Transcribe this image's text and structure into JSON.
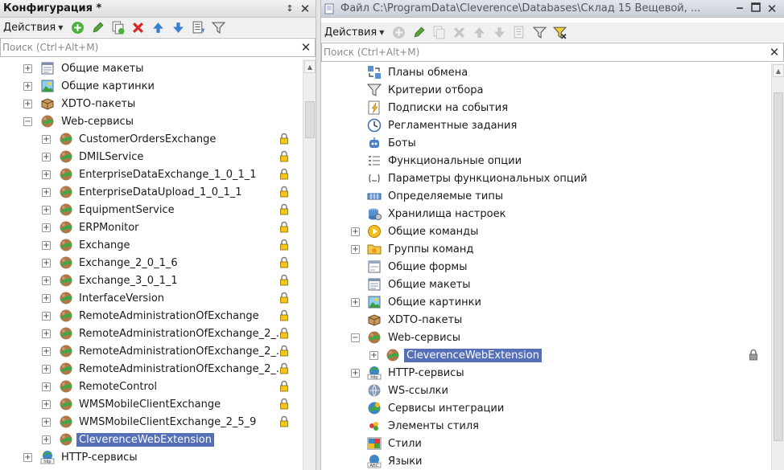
{
  "left_panel": {
    "title": "Конфигурация *",
    "actions_label": "Действия",
    "search_placeholder": "Поиск (Ctrl+Alt+M)",
    "tree": [
      {
        "label": "Общие макеты",
        "icon": "layout-icon",
        "expander": "+",
        "level": 0
      },
      {
        "label": "Общие картинки",
        "icon": "picture-icon",
        "expander": "+",
        "level": 0
      },
      {
        "label": "XDTO-пакеты",
        "icon": "xdto-package-icon",
        "expander": "+",
        "level": 0
      },
      {
        "label": "Web-сервисы",
        "icon": "web-service-icon",
        "expander": "−",
        "level": 0
      },
      {
        "label": "CustomerOrdersExchange",
        "icon": "web-service-icon",
        "expander": "+",
        "level": 1,
        "locked": true
      },
      {
        "label": "DMILService",
        "icon": "web-service-icon",
        "expander": "+",
        "level": 1,
        "locked": true
      },
      {
        "label": "EnterpriseDataExchange_1_0_1_1",
        "icon": "web-service-icon",
        "expander": "+",
        "level": 1,
        "locked": true
      },
      {
        "label": "EnterpriseDataUpload_1_0_1_1",
        "icon": "web-service-icon",
        "expander": "+",
        "level": 1,
        "locked": true
      },
      {
        "label": "EquipmentService",
        "icon": "web-service-icon",
        "expander": "+",
        "level": 1,
        "locked": true
      },
      {
        "label": "ERPMonitor",
        "icon": "web-service-icon",
        "expander": "+",
        "level": 1,
        "locked": true
      },
      {
        "label": "Exchange",
        "icon": "web-service-icon",
        "expander": "+",
        "level": 1,
        "locked": true
      },
      {
        "label": "Exchange_2_0_1_6",
        "icon": "web-service-icon",
        "expander": "+",
        "level": 1,
        "locked": true
      },
      {
        "label": "Exchange_3_0_1_1",
        "icon": "web-service-icon",
        "expander": "+",
        "level": 1,
        "locked": true
      },
      {
        "label": "InterfaceVersion",
        "icon": "web-service-icon",
        "expander": "+",
        "level": 1,
        "locked": true
      },
      {
        "label": "RemoteAdministrationOfExchange",
        "icon": "web-service-icon",
        "expander": "+",
        "level": 1,
        "locked": true
      },
      {
        "label": "RemoteAdministrationOfExchange_2_...",
        "icon": "web-service-icon",
        "expander": "+",
        "level": 1,
        "locked": true
      },
      {
        "label": "RemoteAdministrationOfExchange_2_...",
        "icon": "web-service-icon",
        "expander": "+",
        "level": 1,
        "locked": true
      },
      {
        "label": "RemoteAdministrationOfExchange_2_...",
        "icon": "web-service-icon",
        "expander": "+",
        "level": 1,
        "locked": true
      },
      {
        "label": "RemoteControl",
        "icon": "web-service-icon",
        "expander": "+",
        "level": 1,
        "locked": true
      },
      {
        "label": "WMSMobileClientExchange",
        "icon": "web-service-icon",
        "expander": "+",
        "level": 1,
        "locked": true
      },
      {
        "label": "WMSMobileClientExchange_2_5_9",
        "icon": "web-service-icon",
        "expander": "+",
        "level": 1,
        "locked": true
      },
      {
        "label": "CleverenceWebExtension",
        "icon": "web-service-icon",
        "expander": "+",
        "level": 1,
        "selected": true
      },
      {
        "label": "HTTP-сервисы",
        "icon": "http-service-icon",
        "expander": "+",
        "level": 0
      }
    ]
  },
  "right_panel": {
    "title": "Файл C:\\ProgramData\\Cleverence\\Databases\\Склад 15 Вещевой, ...",
    "actions_label": "Действия",
    "search_placeholder": "Поиск (Ctrl+Alt+M)",
    "tree": [
      {
        "label": "Планы обмена",
        "icon": "exchange-plan-icon",
        "level": 0
      },
      {
        "label": "Критерии отбора",
        "icon": "filter-criteria-icon",
        "level": 0
      },
      {
        "label": "Подписки на события",
        "icon": "event-subscription-icon",
        "level": 0
      },
      {
        "label": "Регламентные задания",
        "icon": "scheduled-job-icon",
        "level": 0
      },
      {
        "label": "Боты",
        "icon": "bot-icon",
        "level": 0
      },
      {
        "label": "Функциональные опции",
        "icon": "functional-option-icon",
        "level": 0
      },
      {
        "label": "Параметры функциональных опций",
        "icon": "functional-option-param-icon",
        "level": 0
      },
      {
        "label": "Определяемые типы",
        "icon": "defined-type-icon",
        "level": 0
      },
      {
        "label": "Хранилища настроек",
        "icon": "settings-storage-icon",
        "level": 0
      },
      {
        "label": "Общие команды",
        "icon": "common-command-icon",
        "expander": "+",
        "level": 0
      },
      {
        "label": "Группы команд",
        "icon": "command-group-icon",
        "expander": "+",
        "level": 0
      },
      {
        "label": "Общие формы",
        "icon": "common-form-icon",
        "level": 0
      },
      {
        "label": "Общие макеты",
        "icon": "layout-icon",
        "level": 0
      },
      {
        "label": "Общие картинки",
        "icon": "picture-icon",
        "expander": "+",
        "level": 0
      },
      {
        "label": "XDTO-пакеты",
        "icon": "xdto-package-icon",
        "level": 0
      },
      {
        "label": "Web-сервисы",
        "icon": "web-service-icon",
        "expander": "−",
        "level": 0
      },
      {
        "label": "CleverenceWebExtension",
        "icon": "web-service-icon",
        "expander": "+",
        "level": 1,
        "selected": true,
        "locked": true
      },
      {
        "label": "HTTP-сервисы",
        "icon": "http-service-icon",
        "expander": "+",
        "level": 0
      },
      {
        "label": "WS-ссылки",
        "icon": "ws-reference-icon",
        "level": 0
      },
      {
        "label": "Сервисы интеграции",
        "icon": "integration-service-icon",
        "level": 0
      },
      {
        "label": "Элементы стиля",
        "icon": "style-item-icon",
        "level": 0
      },
      {
        "label": "Стили",
        "icon": "style-icon",
        "level": 0
      },
      {
        "label": "Языки",
        "icon": "language-icon",
        "level": 0
      }
    ]
  },
  "colors": {
    "selection": "#5570b6",
    "toolbar": "#f0f0f0"
  }
}
